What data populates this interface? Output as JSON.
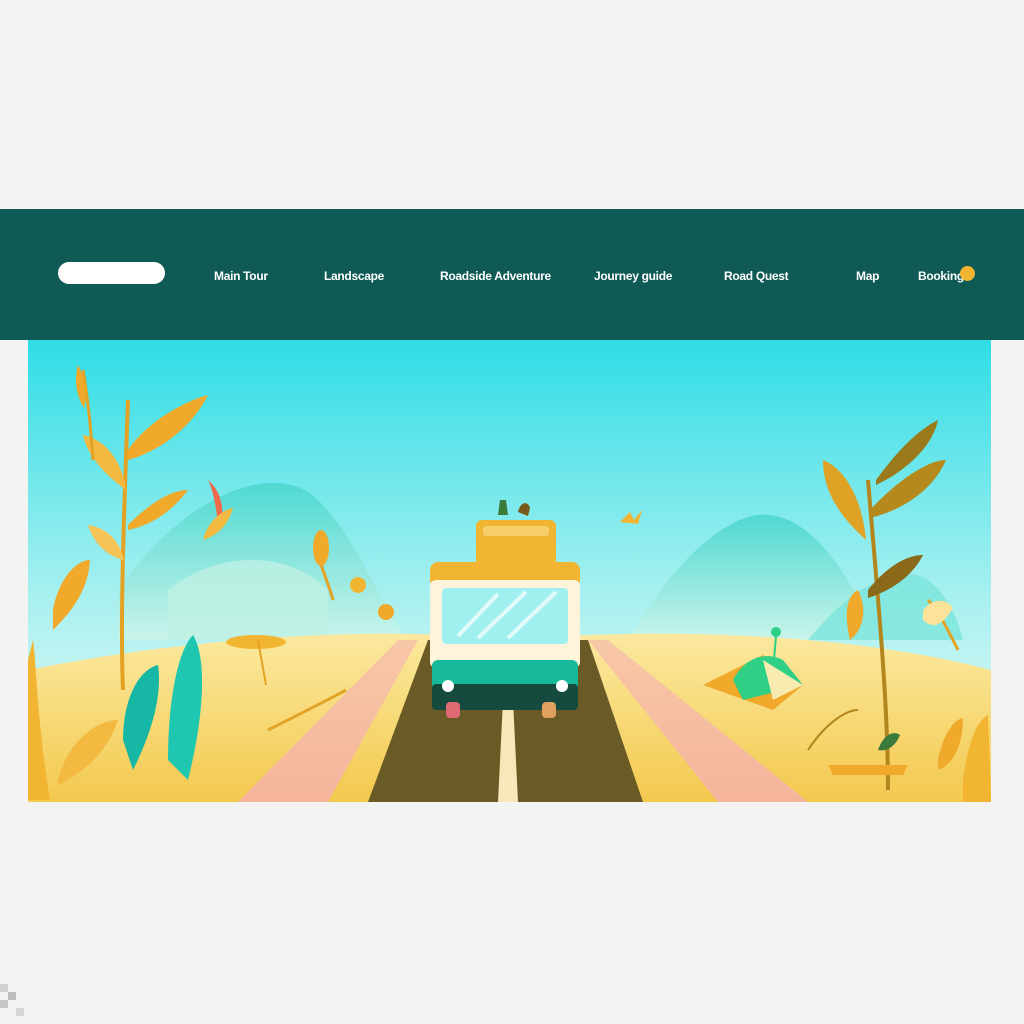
{
  "header": {
    "logo_icon": "logo-pill",
    "nav": [
      {
        "label": "Main Tour"
      },
      {
        "label": "Landscape"
      },
      {
        "label": "Roadside Adventure"
      },
      {
        "label": "Journey guide"
      },
      {
        "label": "Road Quest"
      },
      {
        "label": "Map"
      },
      {
        "label": "Booking"
      }
    ],
    "status_icon": "yellow-dot-icon"
  },
  "hero": {
    "illustration": "road-trip-scene",
    "subjects": [
      "yellow-van",
      "road",
      "hills",
      "plants",
      "bird"
    ]
  },
  "colors": {
    "page_bg": "#f3f3f1",
    "nav_bg": "#0f5a55",
    "accent_yellow": "#f2b531",
    "sky_top": "#2fdde6",
    "sky_bottom": "#e6fbf6",
    "hill": "#5fe0d6",
    "sand": "#f7dc72",
    "road": "#6a5a25"
  }
}
